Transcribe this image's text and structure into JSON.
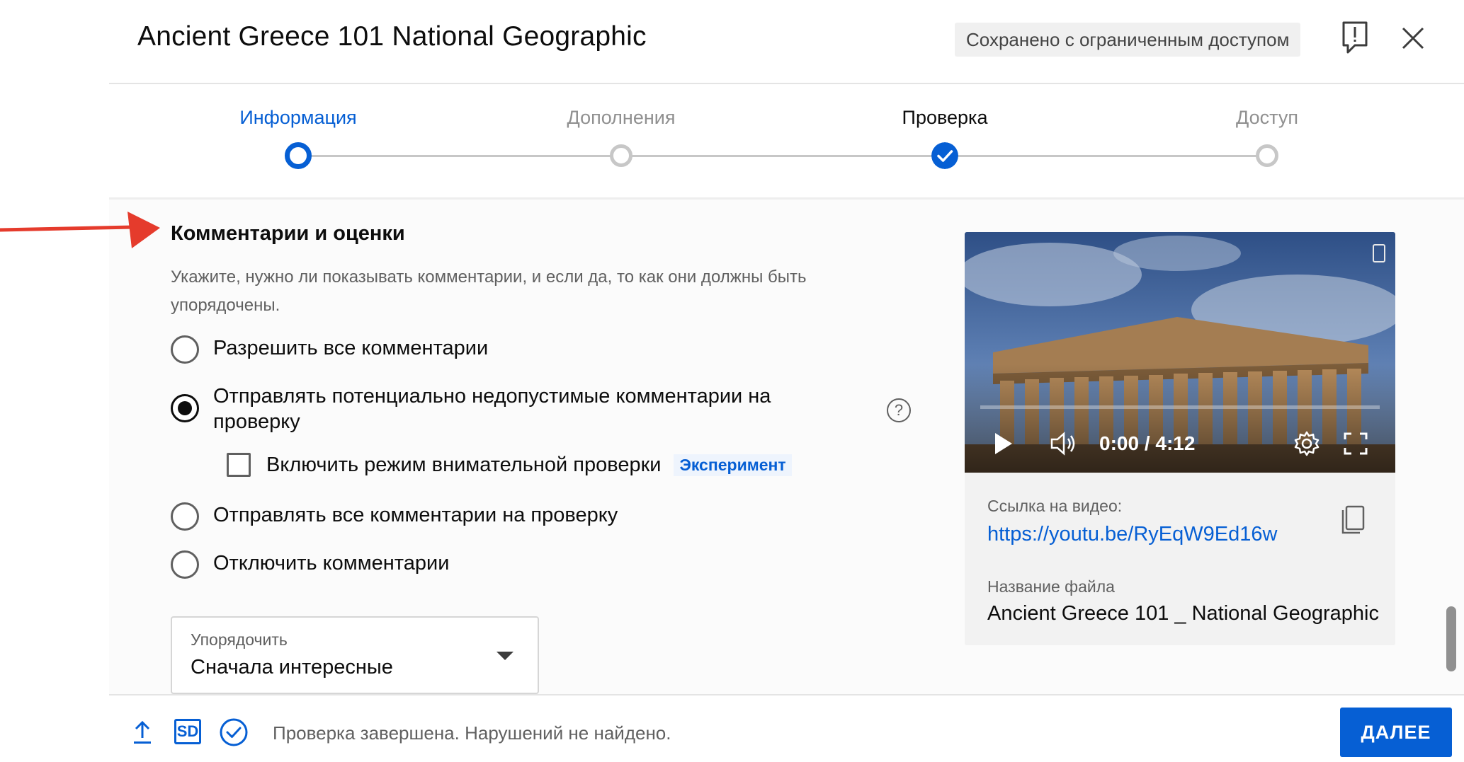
{
  "header": {
    "title": "Ancient Greece 101 National Geographic",
    "saved_badge": "Сохранено с ограниченным доступом"
  },
  "stepper": {
    "steps": [
      {
        "label": "Информация",
        "state": "active"
      },
      {
        "label": "Дополнения",
        "state": "pending"
      },
      {
        "label": "Проверка",
        "state": "done"
      },
      {
        "label": "Доступ",
        "state": "pending"
      }
    ]
  },
  "comments": {
    "title": "Комментарии и оценки",
    "description": "Укажите, нужно ли показывать комментарии, и если да, то как они должны быть упорядочены.",
    "options": [
      {
        "label": "Разрешить все комментарии",
        "checked": false
      },
      {
        "label": "Отправлять потенциально недопустимые комментарии на проверку",
        "checked": true
      },
      {
        "label": "Отправлять все комментарии на проверку",
        "checked": false
      },
      {
        "label": "Отключить комментарии",
        "checked": false
      }
    ],
    "strict_mode": {
      "label": "Включить режим внимательной проверки",
      "badge": "Эксперимент",
      "checked": false
    },
    "sort": {
      "caption": "Упорядочить",
      "value": "Сначала интересные"
    }
  },
  "video": {
    "time": "0:00 / 4:12",
    "link_caption": "Ссылка на видео:",
    "link": "https://youtu.be/RyEqW9Ed16w",
    "file_caption": "Название файла",
    "file_name": "Ancient Greece 101 _ National Geographic"
  },
  "footer": {
    "sd_label": "SD",
    "status": "Проверка завершена. Нарушений не найдено.",
    "next_label": "ДАЛЕЕ"
  },
  "colors": {
    "accent": "#065fd4",
    "arrow": "#e53b2c",
    "text": "#0d0d0d",
    "secondary_text": "#606060"
  }
}
